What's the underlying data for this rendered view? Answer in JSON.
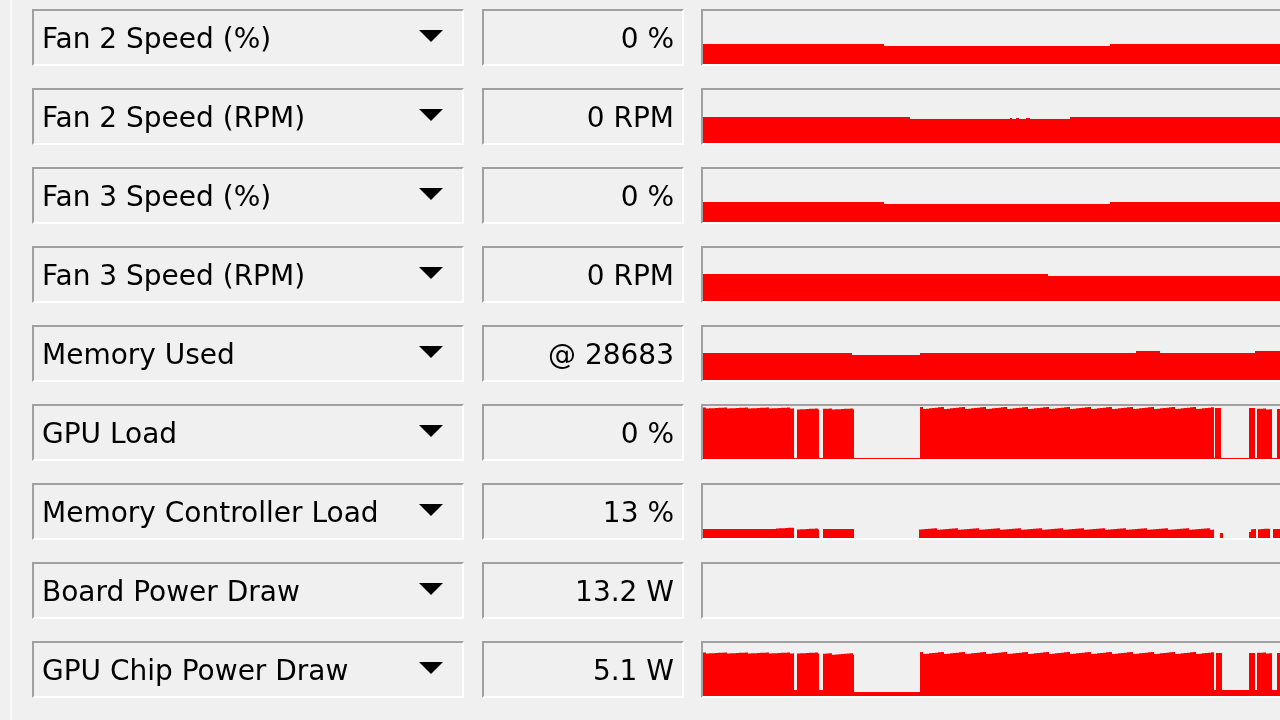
{
  "sensors": [
    {
      "name": "Fan 2 Speed (%)",
      "value": "0 %"
    },
    {
      "name": "Fan 2 Speed (RPM)",
      "value": "0 RPM"
    },
    {
      "name": "Fan 3 Speed (%)",
      "value": "0 %"
    },
    {
      "name": "Fan 3 Speed (RPM)",
      "value": "0 RPM"
    },
    {
      "name": "Memory Used",
      "value": "@ 28683"
    },
    {
      "name": "GPU Load",
      "value": "0 %"
    },
    {
      "name": "Memory Controller Load",
      "value": "13 %"
    },
    {
      "name": "Board Power Draw",
      "value": "13.2 W"
    },
    {
      "name": "GPU Chip Power Draw",
      "value": "5.1 W"
    }
  ]
}
